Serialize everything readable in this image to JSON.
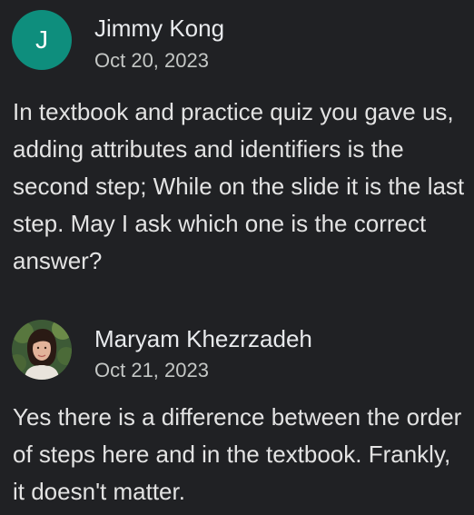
{
  "comments": [
    {
      "avatar": {
        "type": "letter",
        "letter": "J",
        "color": "#0e8e7d"
      },
      "author": "Jimmy Kong",
      "date": "Oct 20, 2023",
      "text": "In textbook and practice quiz you gave us, adding attributes and identifiers is the second step; While on the slide it is the last step. May I ask which one is the correct answer?"
    },
    {
      "avatar": {
        "type": "photo"
      },
      "author": "Maryam Khezrzadeh",
      "date": "Oct 21, 2023",
      "text": "Yes there is a difference between the order of steps here and in the textbook. Frankly, it doesn't matter."
    }
  ],
  "colors": {
    "background": "#202124",
    "text": "#e3e3e3",
    "secondary_text": "#c4c7c5"
  }
}
